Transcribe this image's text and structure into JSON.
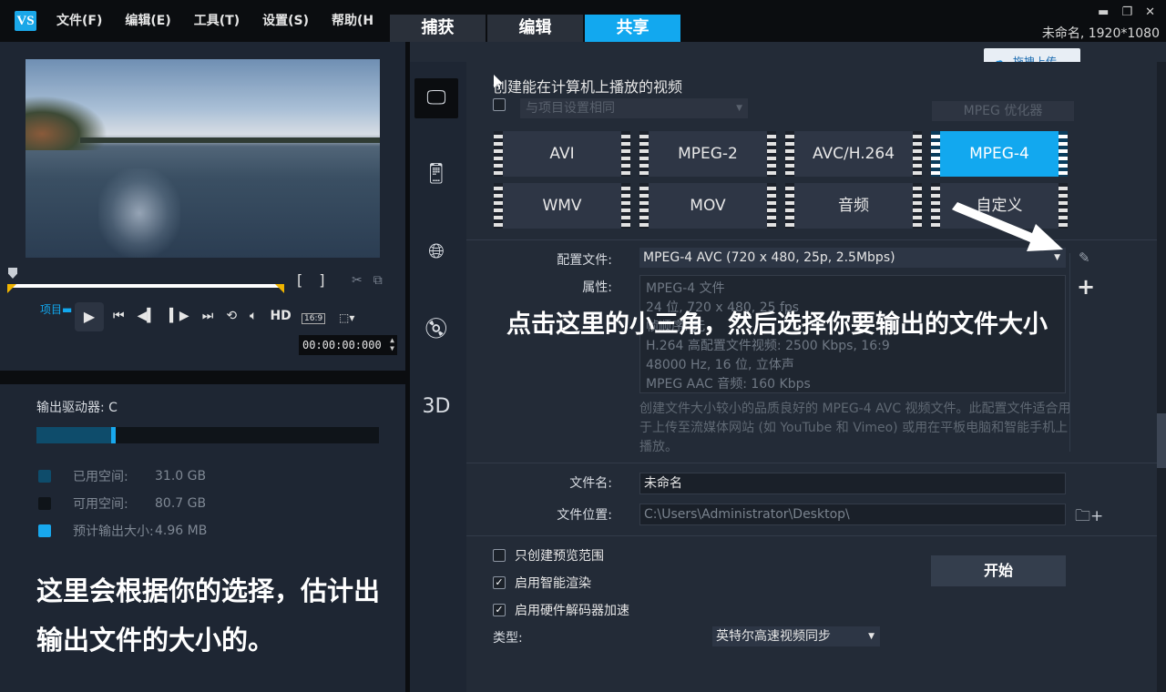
{
  "app": {
    "logo_text": "VS",
    "menu": [
      "文件(F)",
      "编辑(E)",
      "工具(T)",
      "设置(S)",
      "帮助(H"
    ],
    "tabs": [
      "捕获",
      "编辑",
      "共享"
    ],
    "active_tab": "共享",
    "project_title": "未命名, 1920*1080",
    "window_controls": [
      "minimize-icon",
      "restore-icon",
      "close-icon"
    ],
    "accent_color": "#12a8ef"
  },
  "preview": {
    "project_label": "项目",
    "hd_label": "HD",
    "aspect_label": "16:9",
    "timecode": "00:00:00:000"
  },
  "drive": {
    "label": "输出驱动器: C",
    "used_fraction": 0.28,
    "legend": [
      {
        "key": "已用空间:",
        "value": "31.0 GB",
        "color": "#0e4c6b"
      },
      {
        "key": "可用空间:",
        "value": "80.7 GB",
        "color": "#0f1419"
      },
      {
        "key": "预计输出大小:",
        "value": "4.96 MB",
        "color": "#18a8ee"
      }
    ]
  },
  "annotations": {
    "left": "这里会根据你的选择，估计出输出文件的大小的。",
    "right": "点击这里的小三角，然后选择你要输出的文件大小"
  },
  "share": {
    "upload_label": "拖拽上传",
    "heading": "创建能在计算机上播放的视频",
    "same_as_project": "与项目设置相同",
    "mpeg_optimizer": "MPEG 优化器",
    "formats": [
      "AVI",
      "MPEG-2",
      "AVC/H.264",
      "MPEG-4",
      "WMV",
      "MOV",
      "音频",
      "自定义"
    ],
    "active_format": "MPEG-4",
    "profile_label": "配置文件:",
    "profile_value": "MPEG-4 AVC (720 x 480, 25p, 2.5Mbps)",
    "properties_label": "属性:",
    "properties": [
      "MPEG-4 文件",
      "24 位, 720 x 480, 25 fps",
      "帧顺序: 无",
      "H.264 高配置文件视频: 2500 Kbps, 16:9",
      "48000 Hz, 16 位, 立体声",
      "MPEG AAC 音频: 160 Kbps"
    ],
    "description": "创建文件大小较小的品质良好的 MPEG-4 AVC 视频文件。此配置文件适合用于上传至流媒体网站 (如 YouTube 和 Vimeo) 或用在平板电脑和智能手机上播放。",
    "filename_label": "文件名:",
    "filename_value": "未命名",
    "location_label": "文件位置:",
    "location_value": "C:\\Users\\Administrator\\Desktop\\",
    "options": [
      {
        "label": "只创建预览范围",
        "checked": false
      },
      {
        "label": "启用智能渲染",
        "checked": true
      },
      {
        "label": "启用硬件解码器加速",
        "checked": true
      }
    ],
    "start_label": "开始",
    "type_label": "类型:",
    "type_value": "英特尔高速视频同步"
  }
}
